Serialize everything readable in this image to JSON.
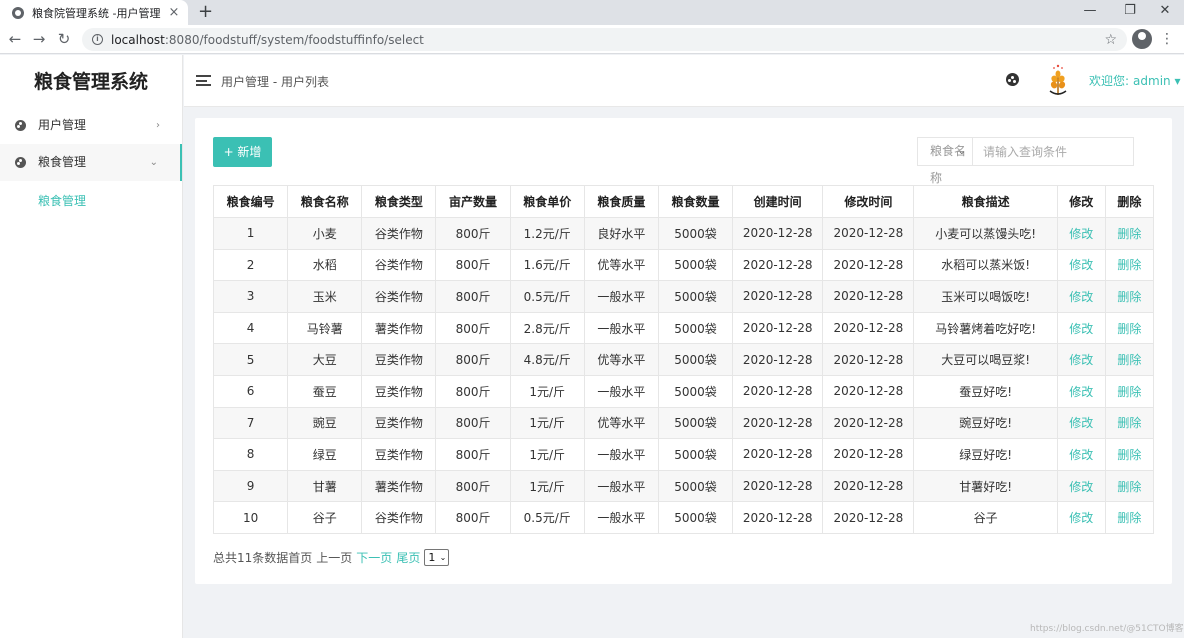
{
  "browser": {
    "tab_title": "粮食院管理系统 -用户管理",
    "tab_close": "×",
    "new_tab": "+",
    "url_host": "localhost",
    "url_path": ":8080/foodstuff/system/foodstuffinfo/select",
    "back": "←",
    "forward": "→",
    "reload": "↻",
    "star": "☆",
    "menu": "⋮",
    "minimize": "—",
    "maximize": "❐",
    "close": "✕"
  },
  "sidebar": {
    "brand": "粮食管理系统",
    "items": [
      {
        "label": "用户管理",
        "chevron": "›"
      },
      {
        "label": "粮食管理",
        "chevron": "⌄"
      }
    ],
    "sub_items": [
      {
        "label": "粮食管理"
      }
    ]
  },
  "header": {
    "breadcrumb": "用户管理 - 用户列表",
    "welcome": "欢迎您:",
    "user": "admin",
    "user_caret": "▾"
  },
  "toolbar": {
    "add_label": "+ 新增",
    "search_field": "粮食名称",
    "search_caret": "⌄",
    "search_placeholder": "请输入查询条件"
  },
  "table": {
    "headers": [
      "粮食编号",
      "粮食名称",
      "粮食类型",
      "亩产数量",
      "粮食单价",
      "粮食质量",
      "粮食数量",
      "创建时间",
      "修改时间",
      "粮食描述",
      "修改",
      "删除"
    ],
    "rows": [
      [
        "1",
        "小麦",
        "谷类作物",
        "800斤",
        "1.2元/斤",
        "良好水平",
        "5000袋",
        "2020-12-28",
        "2020-12-28",
        "小麦可以蒸馒头吃!",
        "修改",
        "删除"
      ],
      [
        "2",
        "水稻",
        "谷类作物",
        "800斤",
        "1.6元/斤",
        "优等水平",
        "5000袋",
        "2020-12-28",
        "2020-12-28",
        "水稻可以蒸米饭!",
        "修改",
        "删除"
      ],
      [
        "3",
        "玉米",
        "谷类作物",
        "800斤",
        "0.5元/斤",
        "一般水平",
        "5000袋",
        "2020-12-28",
        "2020-12-28",
        "玉米可以喝饭吃!",
        "修改",
        "删除"
      ],
      [
        "4",
        "马铃薯",
        "薯类作物",
        "800斤",
        "2.8元/斤",
        "一般水平",
        "5000袋",
        "2020-12-28",
        "2020-12-28",
        "马铃薯烤着吃好吃!",
        "修改",
        "删除"
      ],
      [
        "5",
        "大豆",
        "豆类作物",
        "800斤",
        "4.8元/斤",
        "优等水平",
        "5000袋",
        "2020-12-28",
        "2020-12-28",
        "大豆可以喝豆浆!",
        "修改",
        "删除"
      ],
      [
        "6",
        "蚕豆",
        "豆类作物",
        "800斤",
        "1元/斤",
        "一般水平",
        "5000袋",
        "2020-12-28",
        "2020-12-28",
        "蚕豆好吃!",
        "修改",
        "删除"
      ],
      [
        "7",
        "豌豆",
        "豆类作物",
        "800斤",
        "1元/斤",
        "优等水平",
        "5000袋",
        "2020-12-28",
        "2020-12-28",
        "豌豆好吃!",
        "修改",
        "删除"
      ],
      [
        "8",
        "绿豆",
        "豆类作物",
        "800斤",
        "1元/斤",
        "一般水平",
        "5000袋",
        "2020-12-28",
        "2020-12-28",
        "绿豆好吃!",
        "修改",
        "删除"
      ],
      [
        "9",
        "甘薯",
        "薯类作物",
        "800斤",
        "1元/斤",
        "一般水平",
        "5000袋",
        "2020-12-28",
        "2020-12-28",
        "甘薯好吃!",
        "修改",
        "删除"
      ],
      [
        "10",
        "谷子",
        "谷类作物",
        "800斤",
        "0.5元/斤",
        "一般水平",
        "5000袋",
        "2020-12-28",
        "2020-12-28",
        "谷子",
        "修改",
        "删除"
      ]
    ]
  },
  "pager": {
    "summary": "总共11条数据首页",
    "prev": "上一页",
    "next": "下一页",
    "last": "尾页",
    "page_value": "1",
    "caret": "⌄"
  },
  "watermark": "https://blog.csdn.net/@51CTO博客",
  "colors": {
    "accent": "#3bc0b4",
    "stripe": "#f7f7f7",
    "background": "#f0f2f5"
  }
}
